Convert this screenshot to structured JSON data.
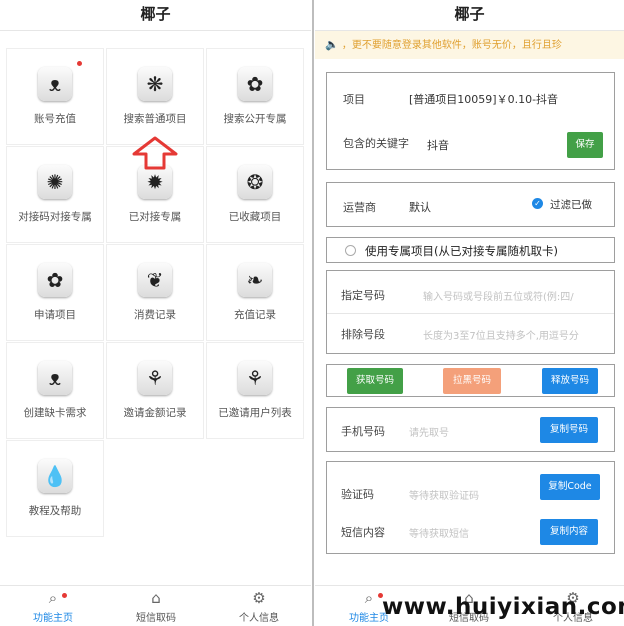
{
  "left": {
    "title": "椰子",
    "menu": [
      {
        "label": "账号充值",
        "icon": "grass-icon",
        "glyph": "ᴥ",
        "badge": true
      },
      {
        "label": "搜索普通项目",
        "icon": "daisy-icon",
        "glyph": "❋",
        "badge": false
      },
      {
        "label": "搜索公开专属",
        "icon": "flower-icon",
        "glyph": "✿",
        "badge": false
      },
      {
        "label": "对接码对接专属",
        "icon": "chrysanthemum-icon",
        "glyph": "✺",
        "badge": false
      },
      {
        "label": "已对接专属",
        "icon": "sunflower-icon",
        "glyph": "✹",
        "badge": false
      },
      {
        "label": "已收藏项目",
        "icon": "ring-flower-icon",
        "glyph": "❂",
        "badge": false
      },
      {
        "label": "申请项目",
        "icon": "blossom-icon",
        "glyph": "✿",
        "badge": false
      },
      {
        "label": "消费记录",
        "icon": "vine-icon",
        "glyph": "❦",
        "badge": false
      },
      {
        "label": "充值记录",
        "icon": "snail-plant-icon",
        "glyph": "❧",
        "badge": false
      },
      {
        "label": "创建缺卡需求",
        "icon": "grass-icon",
        "glyph": "ᴥ",
        "badge": false
      },
      {
        "label": "邀请金额记录",
        "icon": "vase-flower-icon",
        "glyph": "⚘",
        "badge": false
      },
      {
        "label": "已邀请用户列表",
        "icon": "tulip-icon",
        "glyph": "⚘",
        "badge": false
      },
      {
        "label": "教程及帮助",
        "icon": "water-drop-icon",
        "glyph": "💧",
        "badge": false
      }
    ],
    "nav": [
      {
        "label": "功能主页",
        "icon": "search-icon",
        "glyph": "⌕",
        "active": true
      },
      {
        "label": "短信取码",
        "icon": "home-icon",
        "glyph": "⌂",
        "active": false
      },
      {
        "label": "个人信息",
        "icon": "gear-icon",
        "glyph": "⚙",
        "active": false
      }
    ]
  },
  "right": {
    "title": "椰子",
    "notice": "，更不要随意登录其他软件，账号无价，且行且珍",
    "project_label": "项目",
    "project_value": "[普通项目10059]￥0.10-抖音",
    "keyword_label": "包含的关键字",
    "keyword_value": "抖音",
    "save_button": "保存",
    "operator_label": "运营商",
    "operator_value": "默认",
    "filter_label": "过滤已做",
    "exclusive_option": "使用专属项目(从已对接专属随机取卡)",
    "specify_label": "指定号码",
    "specify_placeholder": "输入号码或号段前五位或符(例:四/",
    "exclude_label": "排除号段",
    "exclude_placeholder": "长度为3至7位且支持多个,用逗号分",
    "get_number_button": "获取号码",
    "blacklist_button": "拉黑号码",
    "release_button": "释放号码",
    "phone_label": "手机号码",
    "phone_placeholder": "请先取号",
    "copy_number_button": "复制号码",
    "code_label": "验证码",
    "code_placeholder": "等待获取验证码",
    "copy_code_button": "复制Code",
    "sms_label": "短信内容",
    "sms_placeholder": "等待获取短信",
    "copy_content_button": "复制内容",
    "nav": [
      {
        "label": "功能主页",
        "icon": "search-icon",
        "glyph": "⌕"
      },
      {
        "label": "短信取码",
        "icon": "home-icon",
        "glyph": "⌂"
      },
      {
        "label": "个人信息",
        "icon": "gear-icon",
        "glyph": "⚙"
      }
    ]
  },
  "watermark": "www.huiyixian.com",
  "colors": {
    "accent": "#1e88e5",
    "green": "#43a047",
    "orange": "#f4a07a",
    "notice_bg": "#fdf6e3",
    "notice_text": "#e0a030",
    "badge": "#e53935",
    "arrow": "#e53935"
  }
}
